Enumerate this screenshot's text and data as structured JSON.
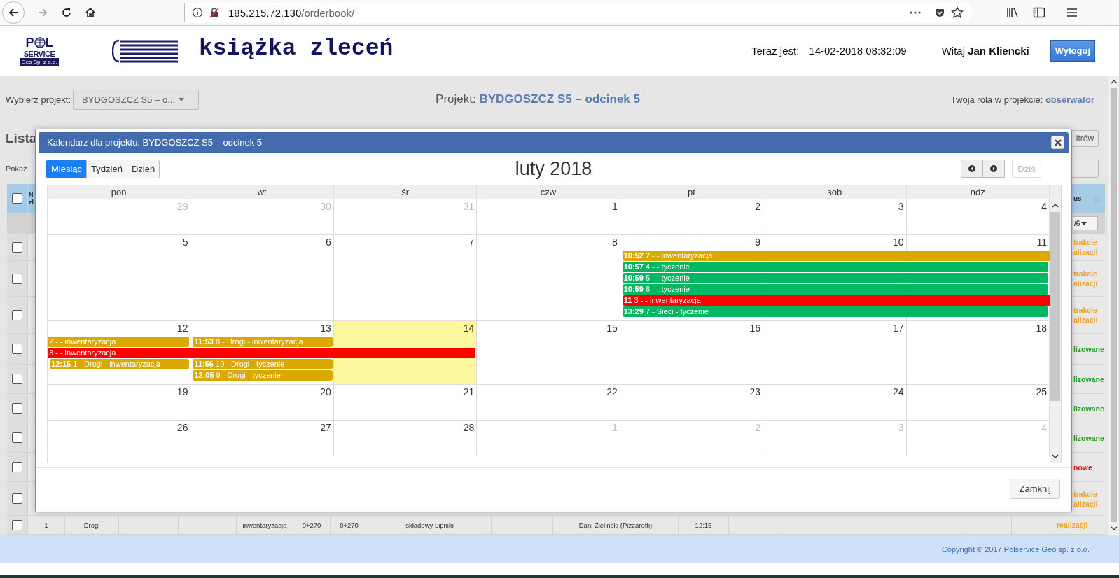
{
  "browser": {
    "url_host": "185.215.72.130",
    "url_path": "/orderbook/"
  },
  "header": {
    "logo": {
      "letter_left": "P",
      "letter_right": "L",
      "word": "SERVICE",
      "sub": "Geo Sp. z o.o."
    },
    "title": "książka zleceń",
    "now_label": "Teraz jest:",
    "now_value": "14-02-2018 08:32:09",
    "greeting": "Witaj",
    "user": "Jan Kliencki",
    "logout": "Wyloguj"
  },
  "project_bar": {
    "select_label": "Wybierz projekt:",
    "select_value": "BYDGOSZCZ S5 – o...",
    "project_label": "Projekt:",
    "project_name": "BYDGOSZCZ S5 – odcinek 5",
    "role_label": "Twoja rola w projekcie:",
    "role": "obserwator"
  },
  "list": {
    "header_checked": false,
    "heading": "Lista",
    "show_label": "Pokaż",
    "filters_button": "ltrów",
    "column_1": "N zl",
    "status_header": "us",
    "status_filter": "/6",
    "rows": [
      {
        "checked": false,
        "status": "trakcie alizacji",
        "kind": "in_progress"
      },
      {
        "checked": false,
        "status": "trakcie alizacji",
        "kind": "in_progress"
      },
      {
        "checked": false,
        "status": "trakcie alizacji",
        "kind": "in_progress"
      },
      {
        "checked": false,
        "status": "lizowane",
        "kind": "done"
      },
      {
        "checked": false,
        "status": "lizowane",
        "kind": "done"
      },
      {
        "checked": false,
        "status": "lizowane",
        "kind": "done"
      },
      {
        "checked": false,
        "status": "lizowane",
        "kind": "done"
      },
      {
        "checked": false,
        "status": "nowe",
        "kind": "new"
      },
      {
        "checked": false,
        "status": "trakcie alizacji",
        "kind": "in_progress"
      }
    ],
    "last_row": {
      "checked": false,
      "cells": [
        "1",
        "Drogi",
        "inwentaryzacja",
        "0+270",
        "0+270",
        "składowy Lipniki",
        "Dani Zielinski (Pizzarotti)",
        "12:15"
      ],
      "status": "realizacji",
      "kind": "in_progress"
    }
  },
  "footer": {
    "copyright": "Copyright © 2017 Polservice Geo sp. z o.o."
  },
  "modal": {
    "title": "Kalendarz dla projektu: BYDGOSZCZ S5 – odcinek 5",
    "views": [
      {
        "label": "Miesiąc",
        "selected": true
      },
      {
        "label": "Tydzień",
        "selected": false
      },
      {
        "label": "Dzień",
        "selected": false
      }
    ],
    "period": "luty 2018",
    "today_button": {
      "label": "Dziś",
      "disabled": true
    },
    "weekdays": [
      "pon",
      "wt",
      "śr",
      "czw",
      "pt",
      "sob",
      "ndz"
    ],
    "weeks": [
      {
        "days": [
          {
            "day": "29",
            "other_month": true,
            "today": false
          },
          {
            "day": "30",
            "other_month": true,
            "today": false
          },
          {
            "day": "31",
            "other_month": true,
            "today": false
          },
          {
            "day": "1",
            "other_month": false,
            "today": false
          },
          {
            "day": "2",
            "other_month": false,
            "today": false
          },
          {
            "day": "3",
            "other_month": false,
            "today": false
          },
          {
            "day": "4",
            "other_month": false,
            "today": false
          }
        ]
      },
      {
        "days": [
          {
            "day": "5",
            "other_month": false,
            "today": false
          },
          {
            "day": "6",
            "other_month": false,
            "today": false
          },
          {
            "day": "7",
            "other_month": false,
            "today": false
          },
          {
            "day": "8",
            "other_month": false,
            "today": false
          },
          {
            "day": "9",
            "other_month": false,
            "today": false,
            "events": [
              {
                "time": "10:52",
                "title": "2 - - inwentaryzacja",
                "color": "#dba800",
                "kind": "triple",
                "continues_before": false,
                "continues_after": true
              },
              {
                "time": "10:57",
                "title": "4 - - tyczenie",
                "color": "#00b862",
                "kind": "triple",
                "continues_before": false,
                "continues_after": false
              },
              {
                "time": "10:59",
                "title": "5 - - tyczenie",
                "color": "#00b862",
                "kind": "triple",
                "continues_before": false,
                "continues_after": false
              },
              {
                "time": "10:59",
                "title": "6 - - tyczenie",
                "color": "#00b862",
                "kind": "triple",
                "continues_before": false,
                "continues_after": false
              },
              {
                "time": "11",
                "title": "3 - - inwentaryzacja",
                "color": "#ff0000",
                "kind": "triple",
                "continues_before": false,
                "continues_after": true
              },
              {
                "time": "13:29",
                "title": "7 - Sieci - tyczenie",
                "color": "#00b862",
                "kind": "triple",
                "continues_before": false,
                "continues_after": false
              }
            ]
          },
          {
            "day": "10",
            "other_month": false,
            "today": false
          },
          {
            "day": "11",
            "other_month": false,
            "today": false
          }
        ]
      },
      {
        "days": [
          {
            "day": "12",
            "other_month": false,
            "today": false,
            "events": [
              {
                "title": "2 - - inwentaryzacja",
                "color": "#dba800",
                "kind": "single",
                "continues_before": true,
                "continues_after": false
              },
              {
                "title": "3 - - inwentaryzacja",
                "color": "#ff0000",
                "kind": "triple",
                "continues_before": true,
                "continues_after": false
              },
              {
                "time": "12:15",
                "title": "1 - Drogi - inwentaryzacja",
                "color": "#dba800",
                "kind": "single",
                "continues_before": false,
                "continues_after": false
              }
            ]
          },
          {
            "day": "13",
            "other_month": false,
            "today": false,
            "events": [
              {
                "time": "11:53",
                "title": "8 - Drogi - inwentaryzacja",
                "color": "#dba800",
                "kind": "single",
                "continues_before": false,
                "continues_after": false
              },
              {
                "time": "11:56",
                "title": "10 - Drogi - tyczenie",
                "color": "#dba800",
                "kind": "single",
                "continues_before": false,
                "continues_after": false
              },
              {
                "time": "12:05",
                "title": "9 - Drogi - tyczenie",
                "color": "#dba800",
                "kind": "single",
                "continues_before": false,
                "continues_after": false
              }
            ]
          },
          {
            "day": "14",
            "other_month": false,
            "today": true
          },
          {
            "day": "15",
            "other_month": false,
            "today": false
          },
          {
            "day": "16",
            "other_month": false,
            "today": false
          },
          {
            "day": "17",
            "other_month": false,
            "today": false
          },
          {
            "day": "18",
            "other_month": false,
            "today": false
          }
        ]
      },
      {
        "days": [
          {
            "day": "19",
            "other_month": false,
            "today": false
          },
          {
            "day": "20",
            "other_month": false,
            "today": false
          },
          {
            "day": "21",
            "other_month": false,
            "today": false
          },
          {
            "day": "22",
            "other_month": false,
            "today": false
          },
          {
            "day": "23",
            "other_month": false,
            "today": false
          },
          {
            "day": "24",
            "other_month": false,
            "today": false
          },
          {
            "day": "25",
            "other_month": false,
            "today": false
          }
        ]
      },
      {
        "days": [
          {
            "day": "26",
            "other_month": false,
            "today": false
          },
          {
            "day": "27",
            "other_month": false,
            "today": false
          },
          {
            "day": "28",
            "other_month": false,
            "today": false
          },
          {
            "day": "1",
            "other_month": true,
            "today": false
          },
          {
            "day": "2",
            "other_month": true,
            "today": false
          },
          {
            "day": "3",
            "other_month": true,
            "today": false
          },
          {
            "day": "4",
            "other_month": true,
            "today": false
          }
        ]
      }
    ],
    "close_button": "Zamknij"
  }
}
